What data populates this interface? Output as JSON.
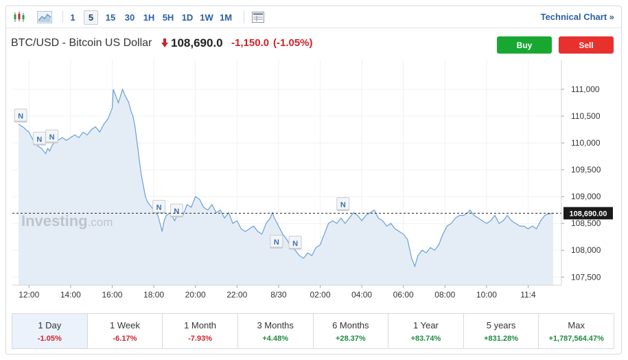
{
  "toolbar": {
    "timeframes": [
      "1",
      "5",
      "15",
      "30",
      "1H",
      "5H",
      "1D",
      "1W",
      "1M"
    ],
    "active_timeframe": "5",
    "technical_chart_label": "Technical Chart »",
    "icons": [
      "candlestick-icon",
      "area-chart-icon",
      "table-icon"
    ]
  },
  "header": {
    "name": "BTC/USD - Bitcoin US Dollar",
    "price": "108,690.0",
    "change": "-1,150.0",
    "change_pct": "(-1.05%)",
    "buy_label": "Buy",
    "sell_label": "Sell"
  },
  "colors": {
    "line": "#6a9fd4",
    "area": "#e4edf6",
    "down": "#d0212a",
    "up": "#1e8a3e",
    "buy": "#18a832",
    "sell": "#e8302c"
  },
  "chart_data": {
    "type": "area",
    "watermark": "Investing.com",
    "x_ticks": [
      "12:00",
      "14:00",
      "16:00",
      "18:00",
      "20:00",
      "22:00",
      "8/30",
      "02:00",
      "04:00",
      "06:00",
      "08:00",
      "10:00",
      "11:4"
    ],
    "y_ticks": [
      111000,
      110500,
      110000,
      109500,
      109000,
      108500,
      108000,
      107500
    ],
    "ylim": [
      107350,
      111550
    ],
    "current_price_label": "108,690.00",
    "current_price": 108690,
    "x_unit": "hours since 12:00",
    "points": [
      [
        -0.5,
        110350
      ],
      [
        -0.3,
        110300
      ],
      [
        0.0,
        110200
      ],
      [
        0.2,
        110050
      ],
      [
        0.4,
        109950
      ],
      [
        0.6,
        109900
      ],
      [
        0.8,
        109800
      ],
      [
        0.9,
        109900
      ],
      [
        1.0,
        109850
      ],
      [
        1.1,
        109950
      ],
      [
        1.2,
        110000
      ],
      [
        1.4,
        110050
      ],
      [
        1.6,
        110100
      ],
      [
        1.8,
        110050
      ],
      [
        2.0,
        110100
      ],
      [
        2.2,
        110150
      ],
      [
        2.4,
        110100
      ],
      [
        2.6,
        110200
      ],
      [
        2.8,
        110150
      ],
      [
        3.0,
        110250
      ],
      [
        3.2,
        110300
      ],
      [
        3.4,
        110200
      ],
      [
        3.6,
        110350
      ],
      [
        3.8,
        110450
      ],
      [
        3.9,
        110550
      ],
      [
        4.0,
        110650
      ],
      [
        4.05,
        111000
      ],
      [
        4.15,
        110900
      ],
      [
        4.3,
        110750
      ],
      [
        4.5,
        111000
      ],
      [
        4.6,
        110900
      ],
      [
        4.8,
        110750
      ],
      [
        4.9,
        110600
      ],
      [
        5.0,
        110500
      ],
      [
        5.1,
        110300
      ],
      [
        5.2,
        110000
      ],
      [
        5.3,
        109700
      ],
      [
        5.4,
        109400
      ],
      [
        5.5,
        109200
      ],
      [
        5.6,
        109000
      ],
      [
        5.7,
        108900
      ],
      [
        5.8,
        108850
      ],
      [
        5.9,
        108800
      ],
      [
        6.0,
        108750
      ],
      [
        6.2,
        108650
      ],
      [
        6.3,
        108500
      ],
      [
        6.4,
        108350
      ],
      [
        6.5,
        108550
      ],
      [
        6.6,
        108650
      ],
      [
        6.8,
        108700
      ],
      [
        7.0,
        108550
      ],
      [
        7.2,
        108700
      ],
      [
        7.4,
        108650
      ],
      [
        7.6,
        108850
      ],
      [
        7.8,
        108800
      ],
      [
        8.0,
        109000
      ],
      [
        8.2,
        108950
      ],
      [
        8.4,
        108800
      ],
      [
        8.6,
        108750
      ],
      [
        8.8,
        108850
      ],
      [
        9.0,
        108700
      ],
      [
        9.2,
        108750
      ],
      [
        9.4,
        108600
      ],
      [
        9.6,
        108700
      ],
      [
        9.8,
        108500
      ],
      [
        10.0,
        108550
      ],
      [
        10.2,
        108400
      ],
      [
        10.4,
        108350
      ],
      [
        10.6,
        108400
      ],
      [
        10.8,
        108450
      ],
      [
        11.0,
        108350
      ],
      [
        11.2,
        108300
      ],
      [
        11.4,
        108500
      ],
      [
        11.6,
        108600
      ],
      [
        11.7,
        108700
      ],
      [
        11.8,
        108600
      ],
      [
        12.0,
        108450
      ],
      [
        12.2,
        108300
      ],
      [
        12.4,
        108200
      ],
      [
        12.6,
        108050
      ],
      [
        12.8,
        108000
      ],
      [
        13.0,
        107900
      ],
      [
        13.2,
        107850
      ],
      [
        13.4,
        107950
      ],
      [
        13.6,
        107900
      ],
      [
        13.8,
        108050
      ],
      [
        14.0,
        108100
      ],
      [
        14.2,
        108300
      ],
      [
        14.4,
        108500
      ],
      [
        14.6,
        108550
      ],
      [
        14.8,
        108500
      ],
      [
        15.0,
        108600
      ],
      [
        15.2,
        108500
      ],
      [
        15.4,
        108600
      ],
      [
        15.6,
        108700
      ],
      [
        15.8,
        108650
      ],
      [
        16.0,
        108550
      ],
      [
        16.2,
        108650
      ],
      [
        16.4,
        108700
      ],
      [
        16.6,
        108750
      ],
      [
        16.8,
        108600
      ],
      [
        17.0,
        108550
      ],
      [
        17.2,
        108450
      ],
      [
        17.4,
        108500
      ],
      [
        17.6,
        108400
      ],
      [
        17.8,
        108350
      ],
      [
        18.0,
        108300
      ],
      [
        18.2,
        108200
      ],
      [
        18.4,
        107850
      ],
      [
        18.55,
        107700
      ],
      [
        18.7,
        107900
      ],
      [
        18.9,
        108000
      ],
      [
        19.1,
        107950
      ],
      [
        19.3,
        108050
      ],
      [
        19.5,
        108000
      ],
      [
        19.7,
        108100
      ],
      [
        19.9,
        108300
      ],
      [
        20.1,
        108450
      ],
      [
        20.3,
        108500
      ],
      [
        20.5,
        108600
      ],
      [
        20.7,
        108650
      ],
      [
        20.9,
        108650
      ],
      [
        21.1,
        108700
      ],
      [
        21.2,
        108750
      ],
      [
        21.4,
        108650
      ],
      [
        21.6,
        108600
      ],
      [
        21.8,
        108550
      ],
      [
        22.0,
        108500
      ],
      [
        22.2,
        108550
      ],
      [
        22.4,
        108650
      ],
      [
        22.6,
        108500
      ],
      [
        22.8,
        108550
      ],
      [
        23.0,
        108650
      ],
      [
        23.2,
        108550
      ],
      [
        23.4,
        108500
      ],
      [
        23.6,
        108450
      ],
      [
        23.8,
        108450
      ],
      [
        24.0,
        108400
      ],
      [
        24.2,
        108450
      ],
      [
        24.4,
        108400
      ],
      [
        24.6,
        108550
      ],
      [
        24.8,
        108650
      ],
      [
        25.0,
        108680
      ],
      [
        25.2,
        108690
      ]
    ],
    "news_markers": [
      {
        "label": "N",
        "t": -0.4,
        "v": 110350
      },
      {
        "label": "N",
        "t": 0.5,
        "v": 109920
      },
      {
        "label": "N",
        "t": 1.1,
        "v": 109960
      },
      {
        "label": "N",
        "t": 6.25,
        "v": 108650
      },
      {
        "label": "N",
        "t": 7.1,
        "v": 108580
      },
      {
        "label": "N",
        "t": 11.9,
        "v": 108000
      },
      {
        "label": "N",
        "t": 12.8,
        "v": 107980
      },
      {
        "label": "N",
        "t": 15.1,
        "v": 108700
      }
    ]
  },
  "periods": [
    {
      "label": "1 Day",
      "value": "-1.05%",
      "dir": "down"
    },
    {
      "label": "1 Week",
      "value": "-6.17%",
      "dir": "down"
    },
    {
      "label": "1 Month",
      "value": "-7.93%",
      "dir": "down"
    },
    {
      "label": "3 Months",
      "value": "+4.48%",
      "dir": "up"
    },
    {
      "label": "6 Months",
      "value": "+28.37%",
      "dir": "up"
    },
    {
      "label": "1 Year",
      "value": "+83.74%",
      "dir": "up"
    },
    {
      "label": "5 years",
      "value": "+831.28%",
      "dir": "up"
    },
    {
      "label": "Max",
      "value": "+1,787,564.47%",
      "dir": "up"
    }
  ]
}
